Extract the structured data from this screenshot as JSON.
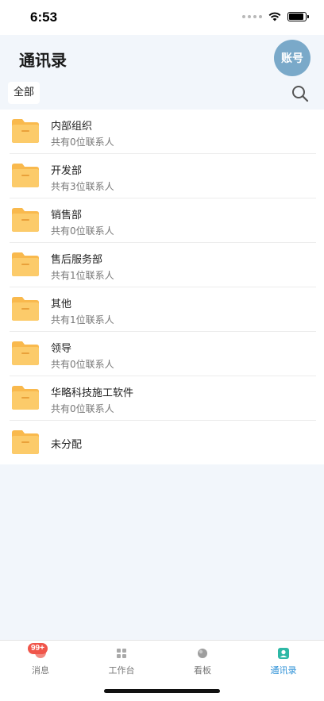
{
  "status_bar": {
    "time": "6:53"
  },
  "header": {
    "title": "通讯录",
    "account_label": "账号"
  },
  "filter": {
    "chip_label": "全部"
  },
  "groups": [
    {
      "name": "内部组织",
      "count_text": "共有0位联系人"
    },
    {
      "name": "开发部",
      "count_text": "共有3位联系人"
    },
    {
      "name": "销售部",
      "count_text": "共有0位联系人"
    },
    {
      "name": "售后服务部",
      "count_text": "共有1位联系人"
    },
    {
      "name": "其他",
      "count_text": "共有1位联系人"
    },
    {
      "name": "领导",
      "count_text": "共有0位联系人"
    },
    {
      "name": "华略科技施工软件",
      "count_text": "共有0位联系人"
    },
    {
      "name": "未分配",
      "count_text": ""
    }
  ],
  "tab_bar": {
    "tabs": [
      {
        "label": "消息",
        "icon": "chat-bubble-icon",
        "badge": "99+"
      },
      {
        "label": "工作台",
        "icon": "grid-icon"
      },
      {
        "label": "看板",
        "icon": "dashboard-icon"
      },
      {
        "label": "通讯录",
        "icon": "contacts-icon",
        "active": true
      }
    ]
  },
  "colors": {
    "background": "#f2f6fb",
    "accent": "#2a8fd6",
    "avatar": "#7aa9c9",
    "folder": "#f9b94d",
    "badge": "#f0554a"
  }
}
